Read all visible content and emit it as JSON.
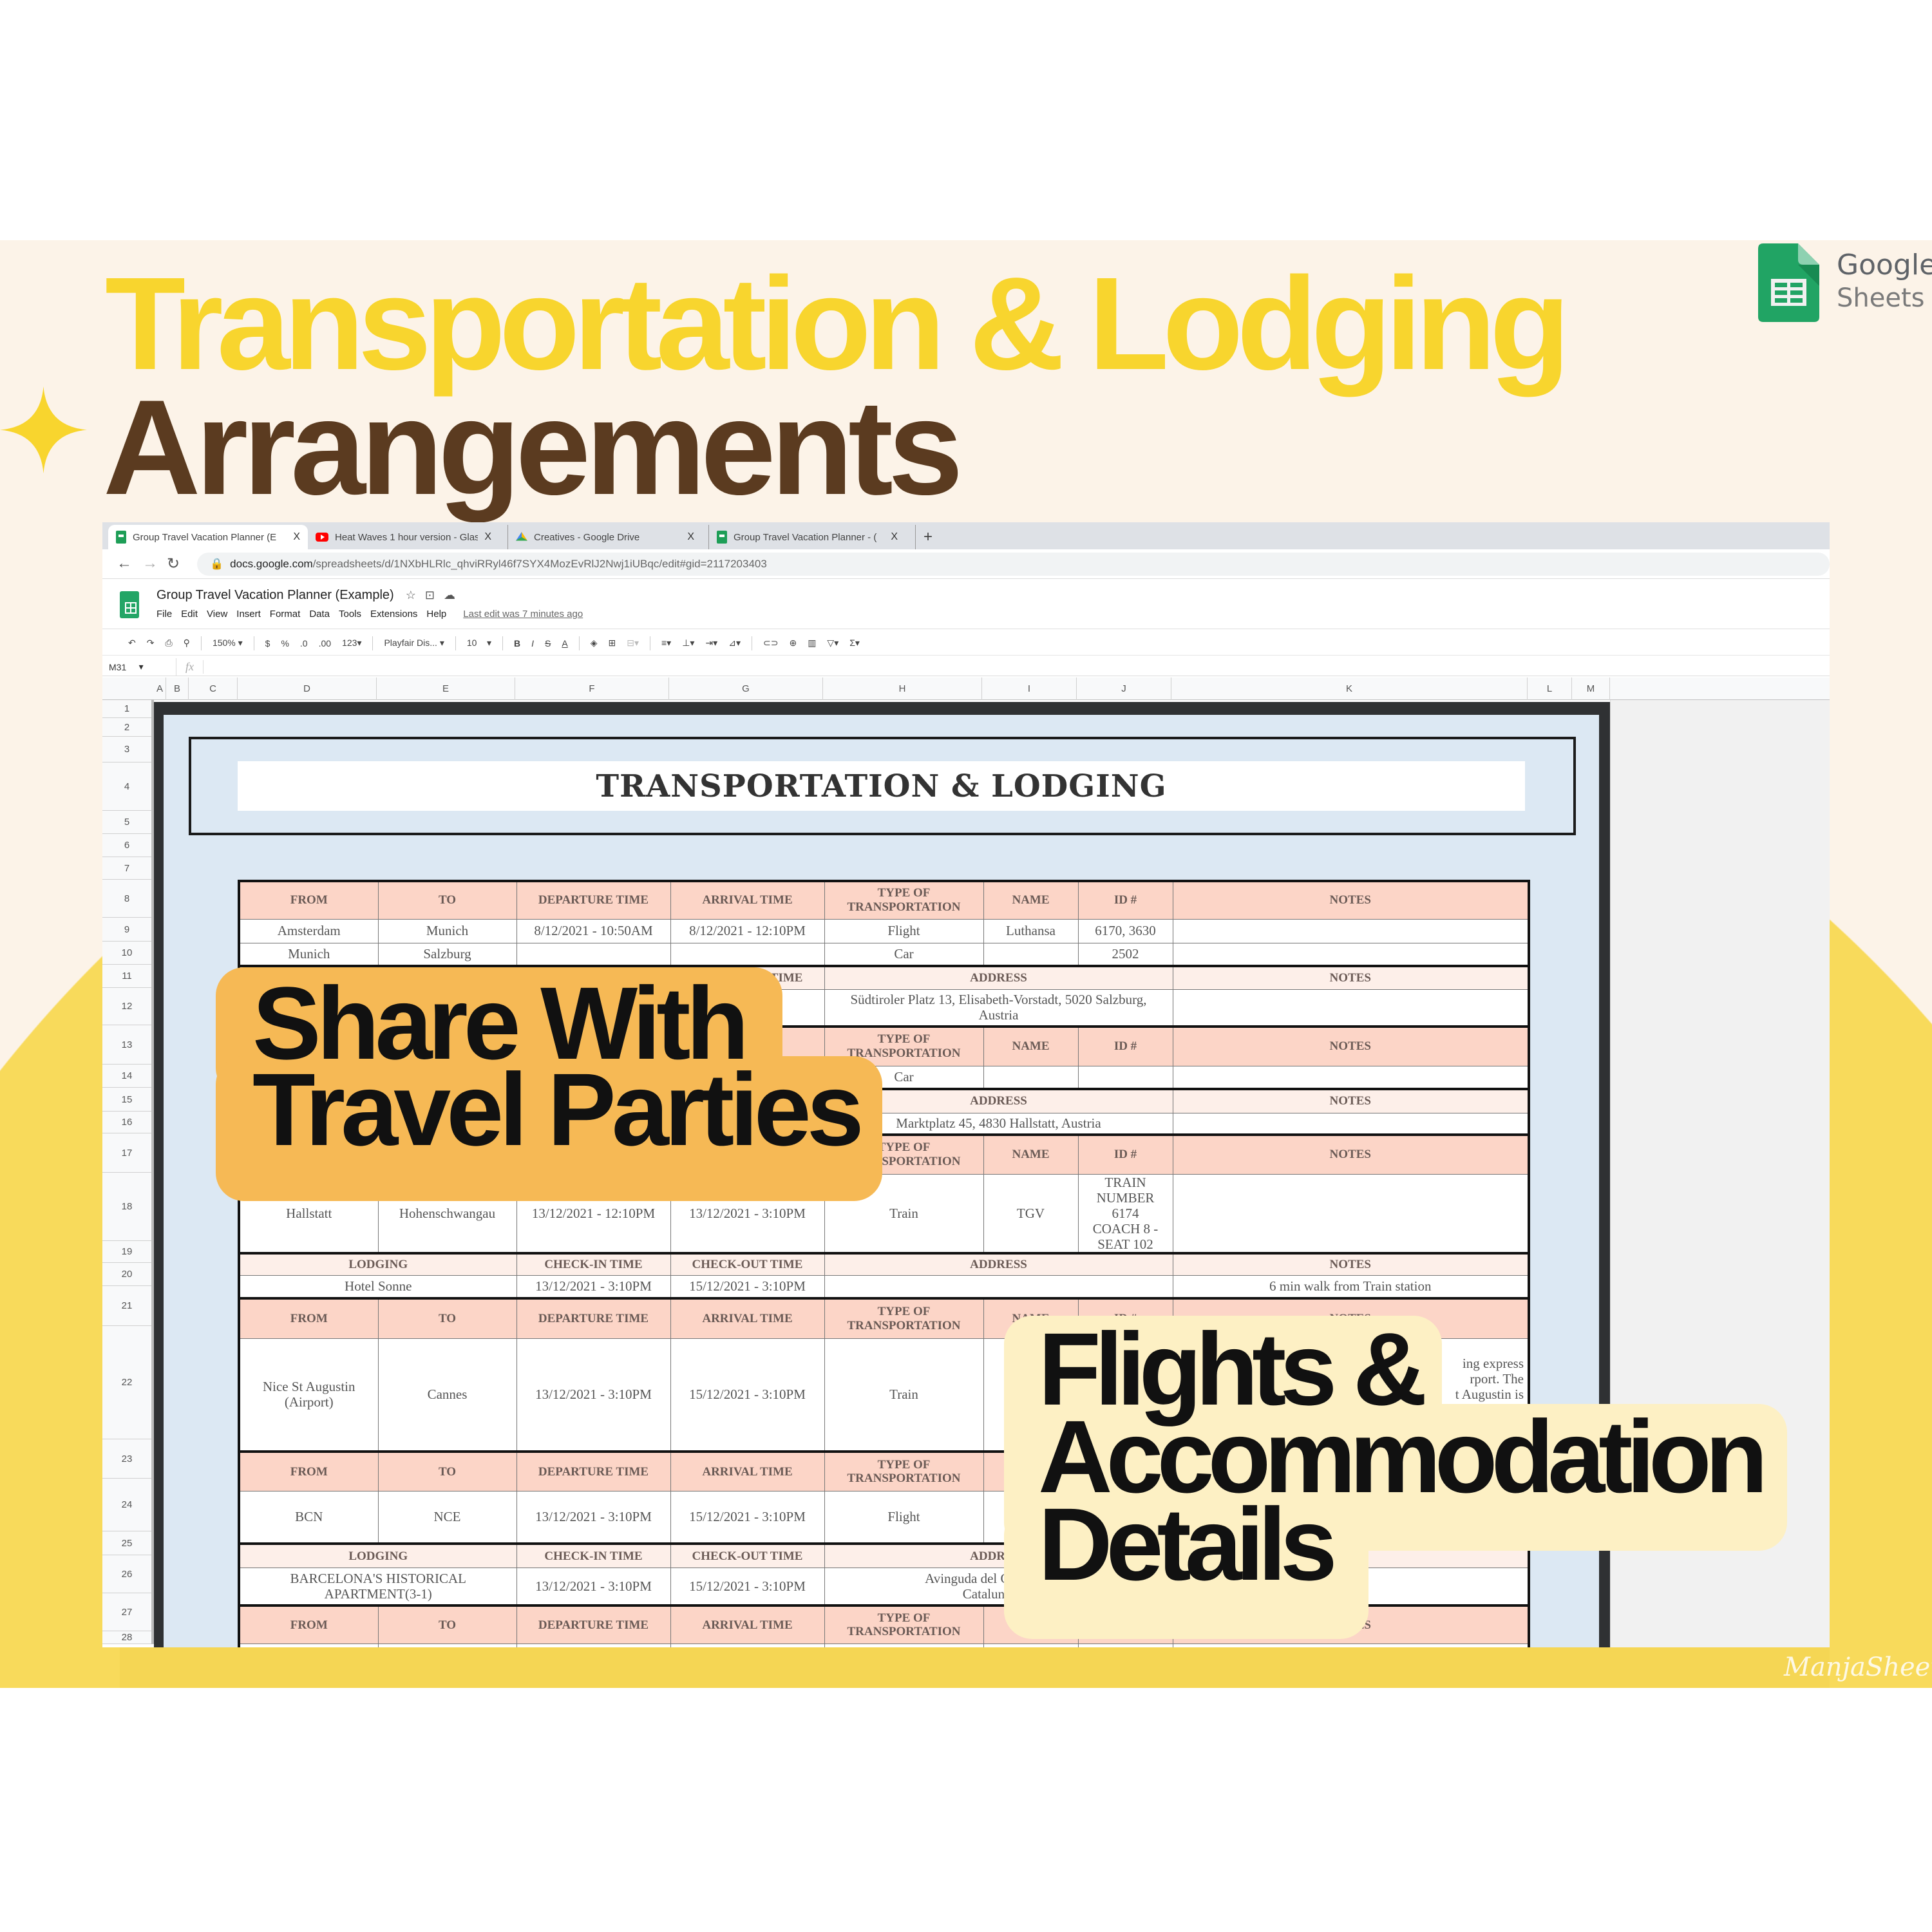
{
  "hero": {
    "title_line1": "Transportation & Lodging",
    "title_line2": "Arrangements",
    "brand_word1": "Google",
    "brand_word2": "Sheets",
    "watermark": "ManjaSheets"
  },
  "colors": {
    "title_yellow": "#f8d52e",
    "title_brown": "#5b3b20",
    "band": "#fcf3e8",
    "circle_yellow": "#f8da5b",
    "header_salmon": "#fcd5c7",
    "header_light": "#fdefe9",
    "badge_orange": "#f6b955",
    "badge_cream": "#fdf0c4",
    "sheets_green": "#1e9e57"
  },
  "browser": {
    "tabs": [
      {
        "label": "Group Travel Vacation Planner (E",
        "icon": "sheets-icon",
        "active": true
      },
      {
        "label": "Heat Waves 1 hour version - Glas",
        "icon": "youtube-icon"
      },
      {
        "label": "Creatives - Google Drive",
        "icon": "drive-icon"
      },
      {
        "label": "Group Travel Vacation Planner - (",
        "icon": "sheets-icon"
      }
    ],
    "close_glyph": "X",
    "new_tab": "+",
    "url_domain": "docs.google.com",
    "url_path": "/spreadsheets/d/1NXbHLRlc_qhviRRyl46f7SYX4MozEvRlJ2Nwj1iUBqc/edit#gid=2117203403"
  },
  "doc": {
    "title": "Group Travel Vacation Planner (Example)",
    "menu": [
      "File",
      "Edit",
      "View",
      "Insert",
      "Format",
      "Data",
      "Tools",
      "Extensions",
      "Help"
    ],
    "last_edit": "Last edit was 7 minutes ago"
  },
  "toolbar": {
    "zoom": "150%",
    "currency": "$",
    "percent": "%",
    "dec_less": ".0",
    "dec_more": ".00",
    "number_format": "123",
    "font": "Playfair Dis...",
    "font_size": "10",
    "bold": "B",
    "italic": "I",
    "strike": "S",
    "text_color": "A"
  },
  "formula_bar": {
    "name_box": "M31",
    "fx": "fx"
  },
  "columns": [
    "A",
    "B",
    "C",
    "D",
    "E",
    "F",
    "G",
    "H",
    "I",
    "J",
    "K",
    "L",
    "M"
  ],
  "rows": [
    "1",
    "2",
    "3",
    "4",
    "5",
    "6",
    "7",
    "8",
    "9",
    "10",
    "11",
    "12",
    "13",
    "14",
    "15",
    "16",
    "17",
    "18",
    "19",
    "20",
    "21",
    "22",
    "23",
    "24",
    "25",
    "26",
    "27",
    "28"
  ],
  "sheet_title": "TRANSPORTATION & LODGING",
  "sections": [
    {
      "type": "transport",
      "header": [
        "FROM",
        "TO",
        "DEPARTURE TIME",
        "ARRIVAL TIME",
        "TYPE OF\nTRANSPORTATION",
        "NAME",
        "ID #",
        "NOTES"
      ],
      "rows": [
        [
          "Amsterdam",
          "Munich",
          "8/12/2021 - 10:50AM",
          "8/12/2021 - 12:10PM",
          "Flight",
          "Luthansa",
          "6170, 3630",
          ""
        ],
        [
          "Munich",
          "Salzburg",
          "",
          "",
          "Car",
          "",
          "2502",
          ""
        ]
      ]
    },
    {
      "type": "lodging",
      "header": [
        "",
        "",
        "CHECK-OUT TIME",
        "ADDRESS",
        "NOTES"
      ],
      "rows": [
        [
          "",
          "",
          "",
          "Südtiroler Platz 13, Elisabeth-Vorstadt, 5020 Salzburg,\nAustria",
          ""
        ]
      ]
    },
    {
      "type": "transport",
      "header": [
        "",
        "",
        "",
        "",
        "TYPE OF\nTRANSPORTATION",
        "NAME",
        "ID #",
        "NOTES"
      ],
      "rows": [
        [
          "",
          "",
          "",
          "",
          "Car",
          "",
          "",
          ""
        ]
      ]
    },
    {
      "type": "lodging",
      "header": [
        "",
        "",
        "",
        "ADDRESS",
        "NOTES"
      ],
      "rows": [
        [
          "",
          "",
          "",
          "Marktplatz 45, 4830 Hallstatt, Austria",
          ""
        ]
      ]
    },
    {
      "type": "transport",
      "header": [
        "",
        "",
        "",
        "",
        "TYPE OF\nTRANSPORTATION",
        "NAME",
        "ID #",
        "NOTES"
      ],
      "rows": [
        [
          "Hallstatt",
          "Hohenschwangau",
          "13/12/2021 - 12:10PM",
          "13/12/2021 - 3:10PM",
          "Train",
          "TGV",
          "TRAIN\nNUMBER 6174\nCOACH 8 -\nSEAT 102",
          ""
        ]
      ]
    },
    {
      "type": "lodging",
      "header": [
        "LODGING",
        "CHECK-IN TIME",
        "CHECK-OUT TIME",
        "ADDRESS",
        "NOTES"
      ],
      "rows": [
        [
          "Hotel Sonne",
          "13/12/2021 - 3:10PM",
          "15/12/2021 - 3:10PM",
          "",
          "6 min walk from Train station"
        ]
      ]
    },
    {
      "type": "transport",
      "header": [
        "FROM",
        "TO",
        "DEPARTURE TIME",
        "ARRIVAL TIME",
        "TYPE OF\nTRANSPORTATION",
        "NAME",
        "ID #",
        "NOTES"
      ],
      "rows": [
        [
          "Nice St Augustin\n(Airport)",
          "Cannes",
          "13/12/2021 - 3:10PM",
          "15/12/2021 - 3:10PM",
          "Train",
          "",
          "",
          "ing express\nrport. The\nt Augustin is\nTram 2 to\nion. See"
        ]
      ]
    },
    {
      "type": "transport",
      "header": [
        "FROM",
        "TO",
        "DEPARTURE TIME",
        "ARRIVAL TIME",
        "TYPE OF\nTRANSPORTATION",
        "",
        "",
        ""
      ],
      "rows": [
        [
          "BCN",
          "NCE",
          "13/12/2021 - 3:10PM",
          "15/12/2021 - 3:10PM",
          "Flight",
          "",
          "",
          ""
        ]
      ]
    },
    {
      "type": "lodging",
      "header": [
        "LODGING",
        "CHECK-IN TIME",
        "CHECK-OUT TIME",
        "ADDRESS",
        ""
      ],
      "rows": [
        [
          "BARCELONA'S HISTORICAL\nAPARTMENT(3-1)",
          "13/12/2021 - 3:10PM",
          "15/12/2021 - 3:10PM",
          "Avinguda del Carrilet, 325,\nCatalunya 08",
          ""
        ]
      ]
    },
    {
      "type": "transport",
      "header": [
        "FROM",
        "TO",
        "DEPARTURE TIME",
        "ARRIVAL TIME",
        "TYPE OF\nTRANSPORTATION",
        "",
        "",
        "NOTES"
      ],
      "rows": [
        [
          "",
          "",
          "",
          "",
          "",
          "",
          "",
          ""
        ]
      ]
    }
  ],
  "badges": {
    "share_line1": "Share With",
    "share_line2": "Travel Parties",
    "flights_line1": "Flights &",
    "flights_line2": "Accommodation",
    "flights_line3": "Details"
  }
}
